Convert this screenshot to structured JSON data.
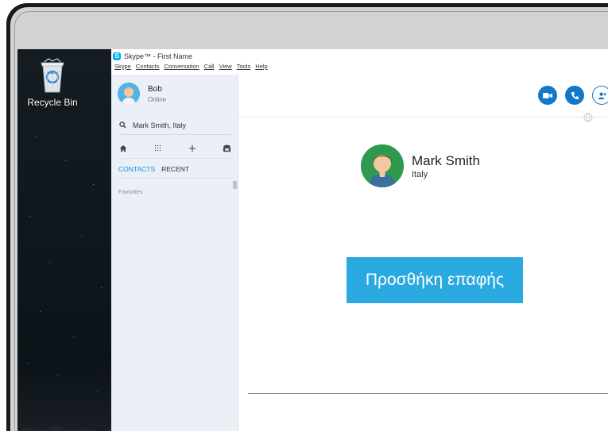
{
  "window": {
    "title": "Skype™ - First Name",
    "logo_letter": "S"
  },
  "menu": [
    "Skype",
    "Contacts",
    "Conversation",
    "Call",
    "View",
    "Tools",
    "Help"
  ],
  "desktop": {
    "recycle_bin_label": "Recycle Bin"
  },
  "profile": {
    "name": "Bob",
    "status": "Online"
  },
  "search": {
    "value": "Mark Smith, Italy"
  },
  "nav_icons": [
    "home-icon",
    "dialpad-icon",
    "add-icon",
    "phone-icon"
  ],
  "tabs": {
    "contacts": "CONTACTS",
    "recent": "RECENT"
  },
  "favorites_label": "Favorites",
  "contact": {
    "name": "Mark Smith",
    "location": "Italy"
  },
  "actions": [
    "video-call-icon",
    "call-icon",
    "add-person-icon"
  ],
  "add_contact_button": "Προσθήκη επαφής",
  "colors": {
    "skype_blue": "#00aff0",
    "action_blue": "#1478c9",
    "button_blue": "#2aa9e0",
    "tab_active": "#1b8bd6",
    "sidebar_bg": "#eaf0f6",
    "avatar_green": "#2f9a4f"
  }
}
